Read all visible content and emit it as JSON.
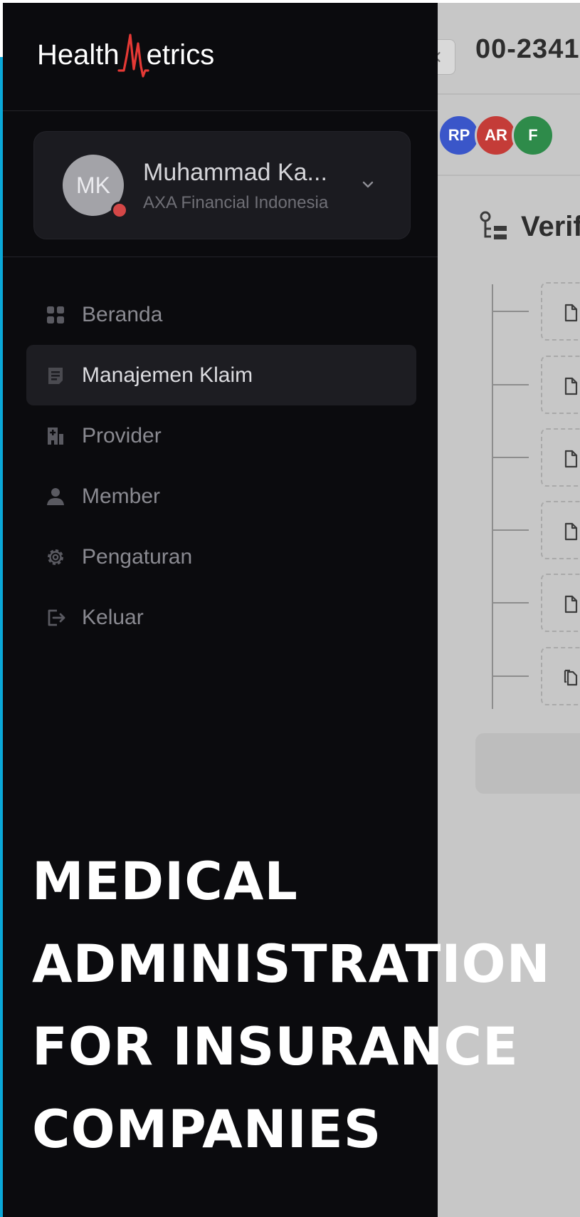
{
  "brand": {
    "logo_left": "Health",
    "logo_right": "etrics"
  },
  "user": {
    "initials": "MK",
    "name": "Muhammad Ka...",
    "company": "AXA Financial Indonesia"
  },
  "nav": {
    "items": [
      {
        "label": "Beranda",
        "icon": "grid-icon",
        "active": false
      },
      {
        "label": "Manajemen Klaim",
        "icon": "clipboard-list-icon",
        "active": true
      },
      {
        "label": "Provider",
        "icon": "hospital-building-icon",
        "active": false
      },
      {
        "label": "Member",
        "icon": "person-icon",
        "active": false
      },
      {
        "label": "Pengaturan",
        "icon": "gear-icon",
        "active": false
      },
      {
        "label": "Keluar",
        "icon": "logout-icon",
        "active": false
      }
    ]
  },
  "main": {
    "claim_id": "00-2341",
    "assignees": [
      {
        "initials": "RP",
        "color": "#3a56c9"
      },
      {
        "initials": "AR",
        "color": "#c43c38"
      },
      {
        "initials": "F",
        "color": "#2e8b4a"
      }
    ],
    "section_title": "Verif",
    "document_rows": 6
  },
  "headline": {
    "lines": [
      "MEDICAL",
      "ADMINISTRATION",
      "FOR INSURANCE",
      "COMPANIES"
    ]
  },
  "colors": {
    "sidebar_bg": "#0b0b0e",
    "accent": "#0aa8d8",
    "logo_pulse": "#e53935",
    "status_dot": "#d44747"
  }
}
